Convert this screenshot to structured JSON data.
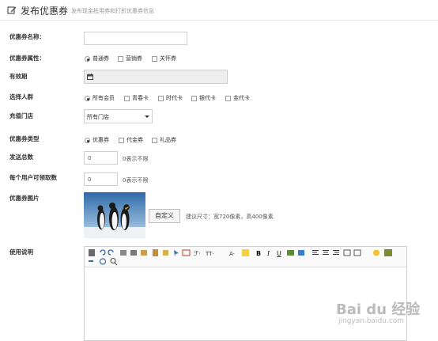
{
  "header": {
    "title": "发布优惠券",
    "subtitle": "发布现金抵用券和打折优惠券信息"
  },
  "fields": {
    "name": {
      "label": "优惠券名称：",
      "value": ""
    },
    "attr": {
      "label": "优惠券属性：",
      "options": [
        "普通券",
        "营销券",
        "关怀券"
      ],
      "selected": 0
    },
    "validity": {
      "label": "有效期",
      "value": ""
    },
    "audience": {
      "label": "选择人群",
      "options": [
        "所有会员",
        "青春卡",
        "时代卡",
        "银代卡",
        "金代卡"
      ],
      "selected": 0
    },
    "store": {
      "label": "充值门店",
      "value": "所有门店"
    },
    "type": {
      "label": "优惠券类型",
      "options": [
        "优惠券",
        "代金券",
        "礼品券"
      ],
      "selected": 0
    },
    "total": {
      "label": "发送总数",
      "value": "0",
      "hint": "0表示不限"
    },
    "per_user": {
      "label": "每个用户可领取数",
      "value": "0",
      "hint": "0表示不限"
    },
    "image": {
      "label": "优惠券图片",
      "button": "自定义",
      "hint": "建议尺寸：宽720像素，高400像素"
    },
    "usage": {
      "label": "使用说明"
    }
  },
  "watermark": {
    "brand": "Bai du 经验",
    "url": "jingyan.baidu.com"
  }
}
